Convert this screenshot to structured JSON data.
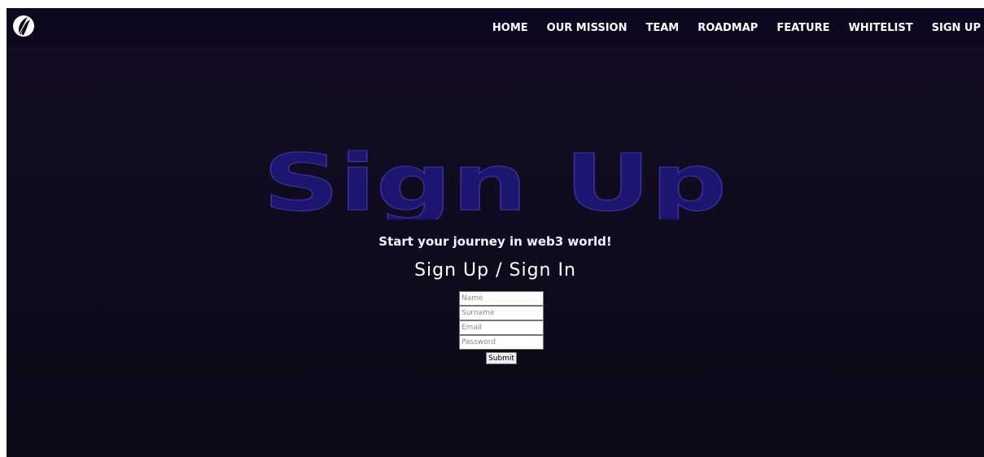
{
  "nav": {
    "logo_icon": "feather-logo-icon",
    "items": [
      {
        "label": "HOME"
      },
      {
        "label": "OUR MISSION"
      },
      {
        "label": "TEAM"
      },
      {
        "label": "ROADMAP"
      },
      {
        "label": "FEATURE"
      },
      {
        "label": "WHITELIST"
      },
      {
        "label": "SIGN UP"
      }
    ]
  },
  "hero": {
    "title": "Sign Up",
    "title_color": "#1d1670",
    "tagline": "Start your journey in web3 world!"
  },
  "form": {
    "heading": "Sign Up / Sign In",
    "fields": {
      "name": {
        "placeholder": "Name",
        "value": ""
      },
      "surname": {
        "placeholder": "Surname",
        "value": ""
      },
      "email": {
        "placeholder": "Email",
        "value": ""
      },
      "password": {
        "placeholder": "Password",
        "value": ""
      }
    },
    "submit_label": "Submit"
  },
  "colors": {
    "background": "#100b1e",
    "navbar": "#0d0820",
    "text": "#ffffff"
  }
}
